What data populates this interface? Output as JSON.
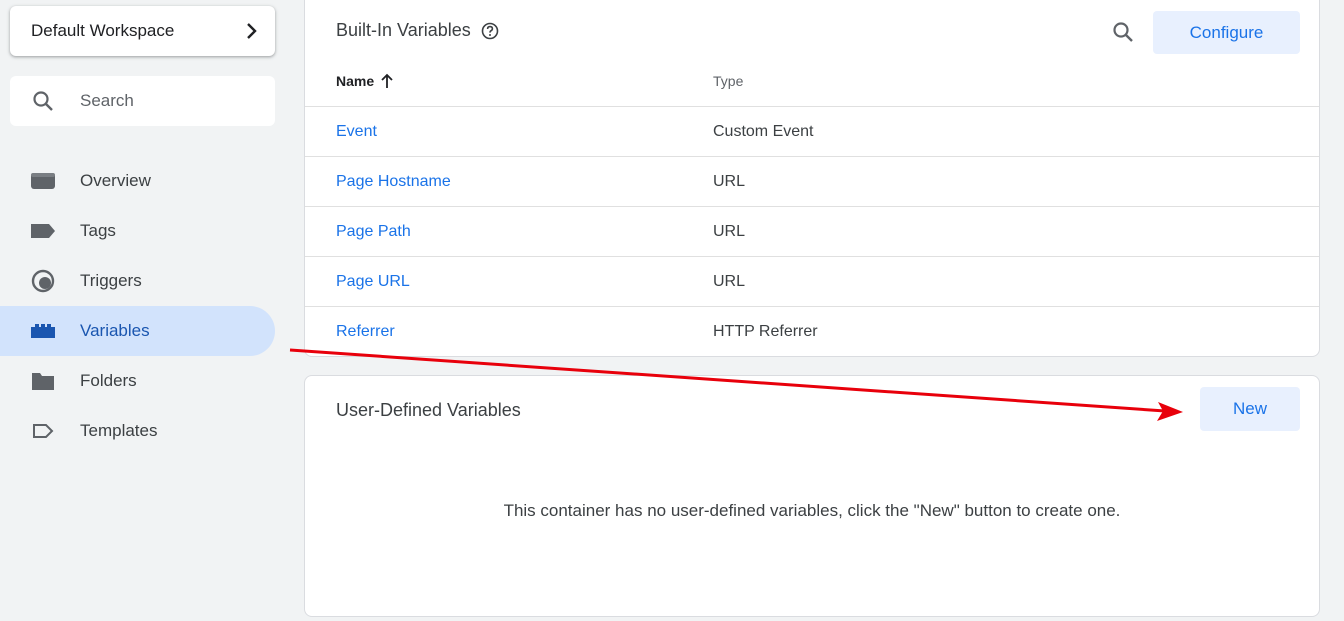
{
  "sidebar": {
    "workspace_label": "Default Workspace",
    "search_placeholder": "Search",
    "items": [
      {
        "label": "Overview",
        "icon": "overview-icon"
      },
      {
        "label": "Tags",
        "icon": "tag-icon"
      },
      {
        "label": "Triggers",
        "icon": "trigger-icon"
      },
      {
        "label": "Variables",
        "icon": "variables-icon",
        "active": true
      },
      {
        "label": "Folders",
        "icon": "folder-icon"
      },
      {
        "label": "Templates",
        "icon": "template-icon"
      }
    ]
  },
  "builtin": {
    "title": "Built-In Variables",
    "configure_label": "Configure",
    "col_name": "Name",
    "col_type": "Type",
    "rows": [
      {
        "name": "Event",
        "type": "Custom Event"
      },
      {
        "name": "Page Hostname",
        "type": "URL"
      },
      {
        "name": "Page Path",
        "type": "URL"
      },
      {
        "name": "Page URL",
        "type": "URL"
      },
      {
        "name": "Referrer",
        "type": "HTTP Referrer"
      }
    ]
  },
  "userdefined": {
    "title": "User-Defined Variables",
    "new_label": "New",
    "empty_message": "This container has no user-defined variables, click the \"New\" button to create one."
  },
  "colors": {
    "accent": "#1a73e8",
    "active_bg": "#d2e3fc",
    "button_bg": "#e8f0fe",
    "annotation_arrow": "#e8000b"
  }
}
